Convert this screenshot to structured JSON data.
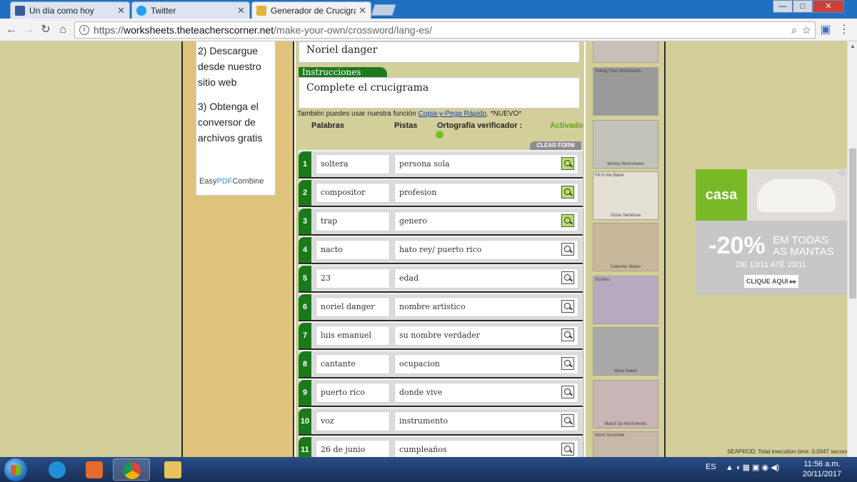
{
  "browser": {
    "tabs": [
      {
        "title": "Un día como hoy",
        "icon": "facebook-icon",
        "active": false
      },
      {
        "title": "Twitter",
        "icon": "twitter-icon",
        "active": false
      },
      {
        "title": "Generador de Crucigram",
        "icon": "crossword-site-icon",
        "active": true
      }
    ],
    "window_controls": {
      "minimize": "—",
      "maximize": "□",
      "close": "✕"
    },
    "address": {
      "scheme": "https://",
      "host": "worksheets.theteacherscorner.net",
      "path": "/make-your-own/crossword/lang-es/"
    }
  },
  "sidebar_ad": {
    "step2": "2) Descargue desde nuestro sitio web",
    "step3": "3) Obtenga el conversor de archivos gratis",
    "logo_prefix": "Easy",
    "logo_pdf": "PDF",
    "logo_suffix": "Combine"
  },
  "form": {
    "title_value": "Noriel danger",
    "instructions_label": "Instrucciones",
    "instructions_value": "Complete el crucigrama",
    "paste_note_prefix": "También puedes usar nuestra función",
    "paste_link": "Copia-y-Pega Rápido",
    "paste_note_suffix": ". *NUEVO*",
    "col_words": "Palabras",
    "col_clues": "Pistas",
    "spell_label": "Ortografía verificador :",
    "spell_status": "Activado",
    "clear_label": "CLEAR FORM",
    "rows": [
      {
        "num": "1",
        "word": "soltera",
        "clue": "persona sola",
        "lit": true
      },
      {
        "num": "2",
        "word": "compositor",
        "clue": "profesion",
        "lit": true
      },
      {
        "num": "3",
        "word": "trap",
        "clue": "genero",
        "lit": true
      },
      {
        "num": "4",
        "word": "nacto",
        "clue": "hato rey/ puerto rico",
        "lit": false
      },
      {
        "num": "5",
        "word": "23",
        "clue": "edad",
        "lit": false
      },
      {
        "num": "6",
        "word": "noriel danger",
        "clue": "nombre artistico",
        "lit": false
      },
      {
        "num": "7",
        "word": "luis emanuel",
        "clue": "su nombre verdader",
        "lit": false
      },
      {
        "num": "8",
        "word": "cantante",
        "clue": "ocupacion",
        "lit": false
      },
      {
        "num": "9",
        "word": "puerto rico",
        "clue": "donde vive",
        "lit": false
      },
      {
        "num": "10",
        "word": "voz",
        "clue": "instrumento",
        "lit": false
      },
      {
        "num": "11",
        "word": "26 de junio",
        "clue": "cumpleaños",
        "lit": false
      }
    ]
  },
  "thumbnails": [
    {
      "label": "",
      "top": "",
      "color": "#b9a8a0"
    },
    {
      "label": "",
      "top": "Telling Time Worksheets",
      "color": "#8f8f8f"
    },
    {
      "label": "Money Worksheets",
      "top": "",
      "color": "#bdbdb5"
    },
    {
      "label": "Cloze Sentence",
      "top": "Fill in the Blank",
      "color": "#e5e0d6"
    },
    {
      "label": "Calendar Maker",
      "top": "",
      "color": "#c9b89c"
    },
    {
      "label": "",
      "top": "Sudoku",
      "color": "#b7aac0"
    },
    {
      "label": "Maze Maker",
      "top": "",
      "color": "#a9a9a9"
    },
    {
      "label": "Match Up Worksheets",
      "top": "",
      "color": "#c9b5b5"
    },
    {
      "label": "",
      "top": "Word Scramble",
      "color": "#c8b8a8"
    }
  ],
  "right_ad": {
    "brand": "casa",
    "percent": "-20%",
    "line1": "EM TODAS",
    "line2": "AS MANTAS",
    "dates": "DE 13/11 ATÉ 23/11",
    "cta": "CLIQUE AQUI ▸▸",
    "brand_color": "#79b927"
  },
  "status_text": "SEAPROD: Total execution time: 0.0047 seconds.",
  "taskbar": {
    "lang": "ES",
    "time": "11:56 a.m.",
    "date": "20/11/2017"
  }
}
